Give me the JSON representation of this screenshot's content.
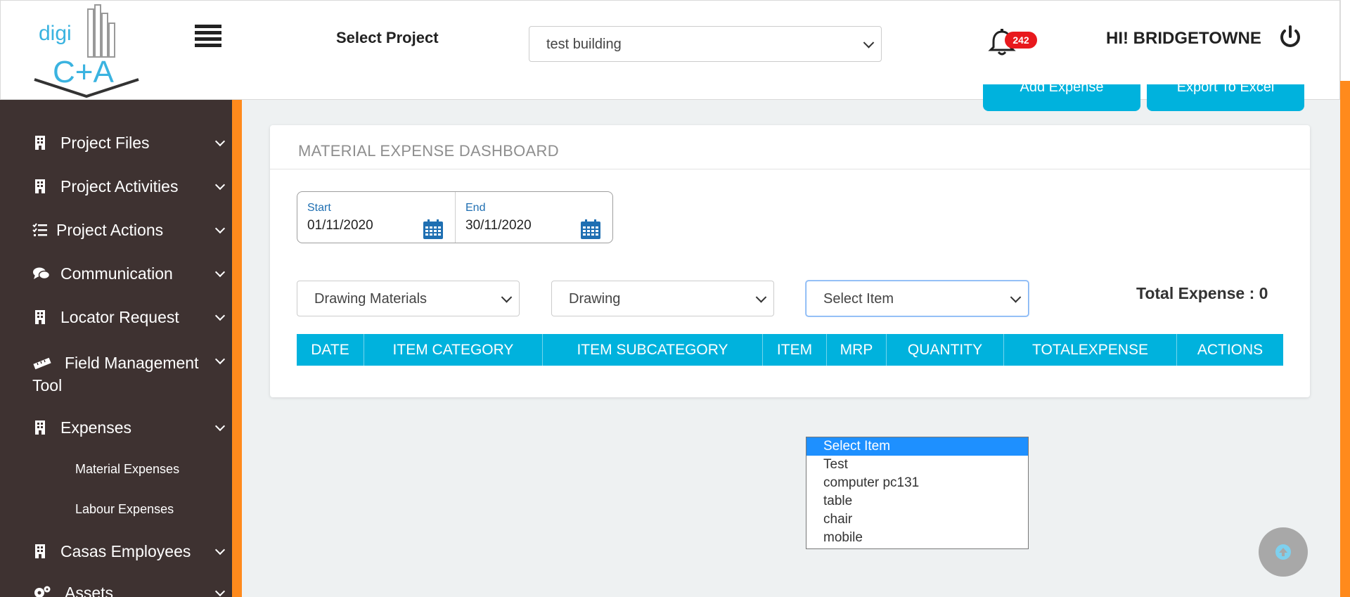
{
  "header": {
    "logo_text_top": "digi",
    "logo_text_bottom": "C+A",
    "select_project_label": "Select Project",
    "project_value": "test building",
    "notification_count": "242",
    "greeting": "HI! BRIDGETOWNE"
  },
  "sidebar": {
    "items": [
      {
        "label": "Project Files",
        "icon": "building-icon"
      },
      {
        "label": "Project Activities",
        "icon": "building-icon"
      },
      {
        "label": "Project Actions",
        "icon": "tasks-icon"
      },
      {
        "label": "Communication",
        "icon": "comments-icon"
      },
      {
        "label": "Locator Request",
        "icon": "building-icon"
      },
      {
        "label": "Field Management",
        "label2": "Tool",
        "icon": "ruler-icon"
      },
      {
        "label": "Expenses",
        "icon": "building-icon"
      },
      {
        "label": "Casas Employees",
        "icon": "building-icon"
      },
      {
        "label": "Assets",
        "icon": "gears-icon"
      }
    ],
    "expenses_subitems": [
      "Material Expenses",
      "Labour Expenses"
    ]
  },
  "top_buttons": {
    "add_expense": "Add Expense",
    "export_excel": "Export To Excel"
  },
  "dashboard": {
    "title": "MATERIAL EXPENSE DASHBOARD",
    "start_label": "Start",
    "start_value": "01/11/2020",
    "end_label": "End",
    "end_value": "30/11/2020",
    "category_value": "Drawing Materials",
    "subcategory_value": "Drawing",
    "item_value": "Select Item",
    "total_expense": "Total Expense : 0",
    "columns": [
      "DATE",
      "ITEM CATEGORY",
      "ITEM SUBCATEGORY",
      "ITEM",
      "MRP",
      "QUANTITY",
      "TOTALEXPENSE",
      "ACTIONS"
    ]
  },
  "item_dropdown": {
    "options": [
      "Select Item",
      "Test",
      "computer pc131",
      "table",
      "chair",
      "mobile"
    ],
    "selected_index": 0
  },
  "colors": {
    "accent": "#00b2dd",
    "sidebar_bg": "#3e3231",
    "orange": "#ff8a1c",
    "badge": "#e8191d"
  }
}
